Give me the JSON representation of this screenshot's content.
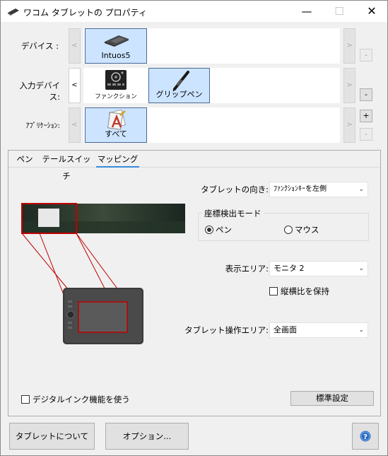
{
  "window": {
    "title": "ワコム タブレットの プロパティ",
    "controls": {
      "minimize": "—",
      "maximize": "☐",
      "close": "✕"
    }
  },
  "devices_row": {
    "label": "デバイス :",
    "prev": "<",
    "next": ">",
    "items": [
      {
        "label": "Intuos5",
        "icon": "tablet-icon",
        "selected": true
      }
    ],
    "side_buttons": [
      "-"
    ]
  },
  "input_devices_row": {
    "label": "入力デバイス:",
    "prev": "<",
    "next": ">",
    "items": [
      {
        "label": "ファンクション",
        "icon": "function-keys-icon",
        "selected": false
      },
      {
        "label": "グリップペン",
        "icon": "pen-icon",
        "selected": true
      }
    ],
    "side_buttons": [
      "-"
    ]
  },
  "applications_row": {
    "label": "ｱﾌﾟﾘｹｰｼｮﾝ:",
    "prev": "<",
    "next": ">",
    "items": [
      {
        "label": "すべて",
        "icon": "all-applications-icon",
        "selected": true
      }
    ],
    "side_buttons": [
      "+",
      "-"
    ]
  },
  "tabs": [
    {
      "label": "ペン",
      "selected": false
    },
    {
      "label": "テールスイッチ",
      "selected": false
    },
    {
      "label": "マッピング",
      "selected": true
    }
  ],
  "mapping": {
    "orientation": {
      "label": "タブレットの向き:",
      "value": "ﾌｧﾝｸｼｮﾝｷｰを左側"
    },
    "mode_group": {
      "title": "座標検出モード",
      "options": [
        {
          "label": "ペン",
          "selected": true
        },
        {
          "label": "マウス",
          "selected": false
        }
      ]
    },
    "screen_area": {
      "label": "表示エリア:",
      "value": "モニタ 2"
    },
    "keep_aspect": {
      "label": "縦横比を保持",
      "checked": false
    },
    "tablet_area": {
      "label": "タブレット操作エリア:",
      "value": "全画面"
    },
    "digital_ink": {
      "label": "デジタルインク機能を使う",
      "checked": false
    },
    "default_button": "標準設定"
  },
  "footer": {
    "about_button": "タブレットについて",
    "options_button": "オプション...",
    "help_icon": "help-icon"
  },
  "colors": {
    "selection_fill": "#cce4ff",
    "selection_border": "#4a6a9a",
    "mapping_red": "#c00000",
    "tab_accent": "#3c8bd8",
    "help_blue": "#2b6cc4"
  }
}
